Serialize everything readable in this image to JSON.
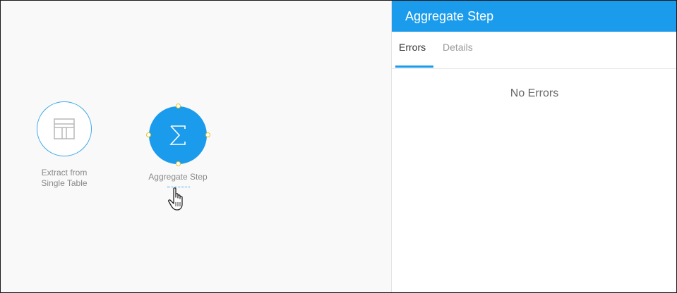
{
  "canvas": {
    "nodes": [
      {
        "label": "Extract from Single Table",
        "label_line1": "Extract from",
        "label_line2": "Single Table",
        "icon": "table-icon"
      },
      {
        "label": "Aggregate Step",
        "icon": "sigma-icon"
      }
    ]
  },
  "panel": {
    "title": "Aggregate Step",
    "tabs": [
      {
        "label": "Errors",
        "active": true
      },
      {
        "label": "Details",
        "active": false
      }
    ],
    "message": "No Errors"
  },
  "colors": {
    "accent": "#1a9bec",
    "handle": "#e8c21a"
  }
}
